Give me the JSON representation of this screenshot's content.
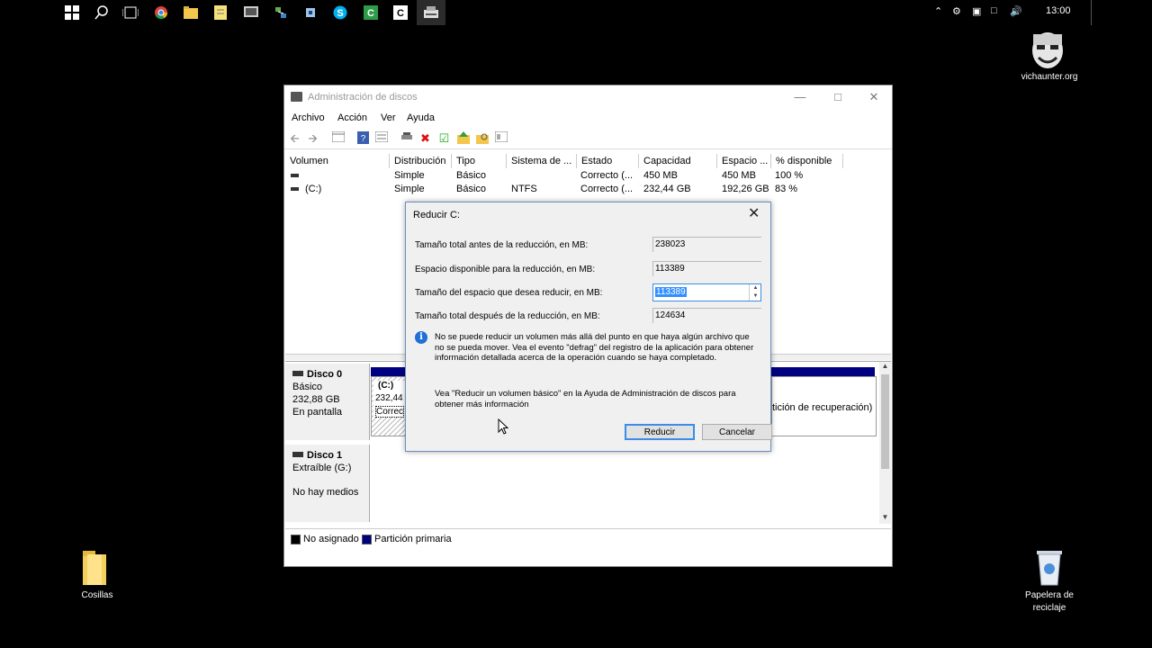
{
  "taskbar": {
    "clock": "13:00",
    "icons": [
      "windows-start-icon",
      "search-icon",
      "task-view-icon",
      "chrome-icon",
      "file-explorer-icon",
      "notes-icon",
      "device-icon",
      "network-icon",
      "settings-icon",
      "skype-icon",
      "c-app-icon",
      "c-app-icon-2",
      "disk-management-icon"
    ]
  },
  "desktop": {
    "user_label": "vichaunter.org",
    "folder_label": "Cosillas",
    "recycle_label_1": "Papelera de",
    "recycle_label_2": "reciclaje"
  },
  "window": {
    "title": "Administración de discos",
    "menu": [
      "Archivo",
      "Acción",
      "Ver",
      "Ayuda"
    ],
    "columns": [
      "Volumen",
      "Distribución",
      "Tipo",
      "Sistema de ...",
      "Estado",
      "Capacidad",
      "Espacio ...",
      "% disponible"
    ],
    "rows": [
      {
        "volumen": "",
        "distribucion": "Simple",
        "tipo": "Básico",
        "sistema": "",
        "estado": "Correcto (...",
        "capacidad": "450 MB",
        "espacio": "450 MB",
        "disponible": "100 %"
      },
      {
        "volumen": "(C:)",
        "distribucion": "Simple",
        "tipo": "Básico",
        "sistema": "NTFS",
        "estado": "Correcto (...",
        "capacidad": "232,44 GB",
        "espacio": "192,26 GB",
        "disponible": "83 %"
      }
    ],
    "disk0": {
      "name": "Disco 0",
      "type": "Básico",
      "size": "232,88 GB",
      "status": "En pantalla",
      "part_name": "(C:)",
      "part_size": "232,44",
      "part_status": "Correc",
      "recovery_text": "tición de recuperación)"
    },
    "disk1": {
      "name": "Disco 1",
      "type": "Extraíble (G:)",
      "status": "No hay medios"
    },
    "legend": {
      "unallocated": "No asignado",
      "primary": "Partición primaria"
    }
  },
  "dialog": {
    "title": "Reducir C:",
    "fields": [
      {
        "label": "Tamaño total antes de la reducción, en MB:",
        "value": "238023"
      },
      {
        "label": "Espacio disponible para la reducción, en MB:",
        "value": "113389"
      },
      {
        "label": "Tamaño del espacio que desea reducir, en MB:",
        "value": "113389"
      },
      {
        "label": "Tamaño total después de la reducción, en MB:",
        "value": "124634"
      }
    ],
    "info_line1": "No se puede reducir un volumen más allá del punto en que haya algún archivo que",
    "info_line2": "no se pueda mover. Vea el evento \"defrag\" del registro de la aplicación para obtener",
    "info_line3": "información detallada acerca de la operación cuando se haya completado.",
    "help_line1": "Vea \"Reducir un volumen básico\"  en la Ayuda de Administración de discos para",
    "help_line2": "obtener más información",
    "reduce_button": "Reducir",
    "cancel_button": "Cancelar"
  },
  "colors": {
    "primary_partition": "#000080",
    "unallocated": "#000000",
    "accent": "#3a8ee6"
  }
}
